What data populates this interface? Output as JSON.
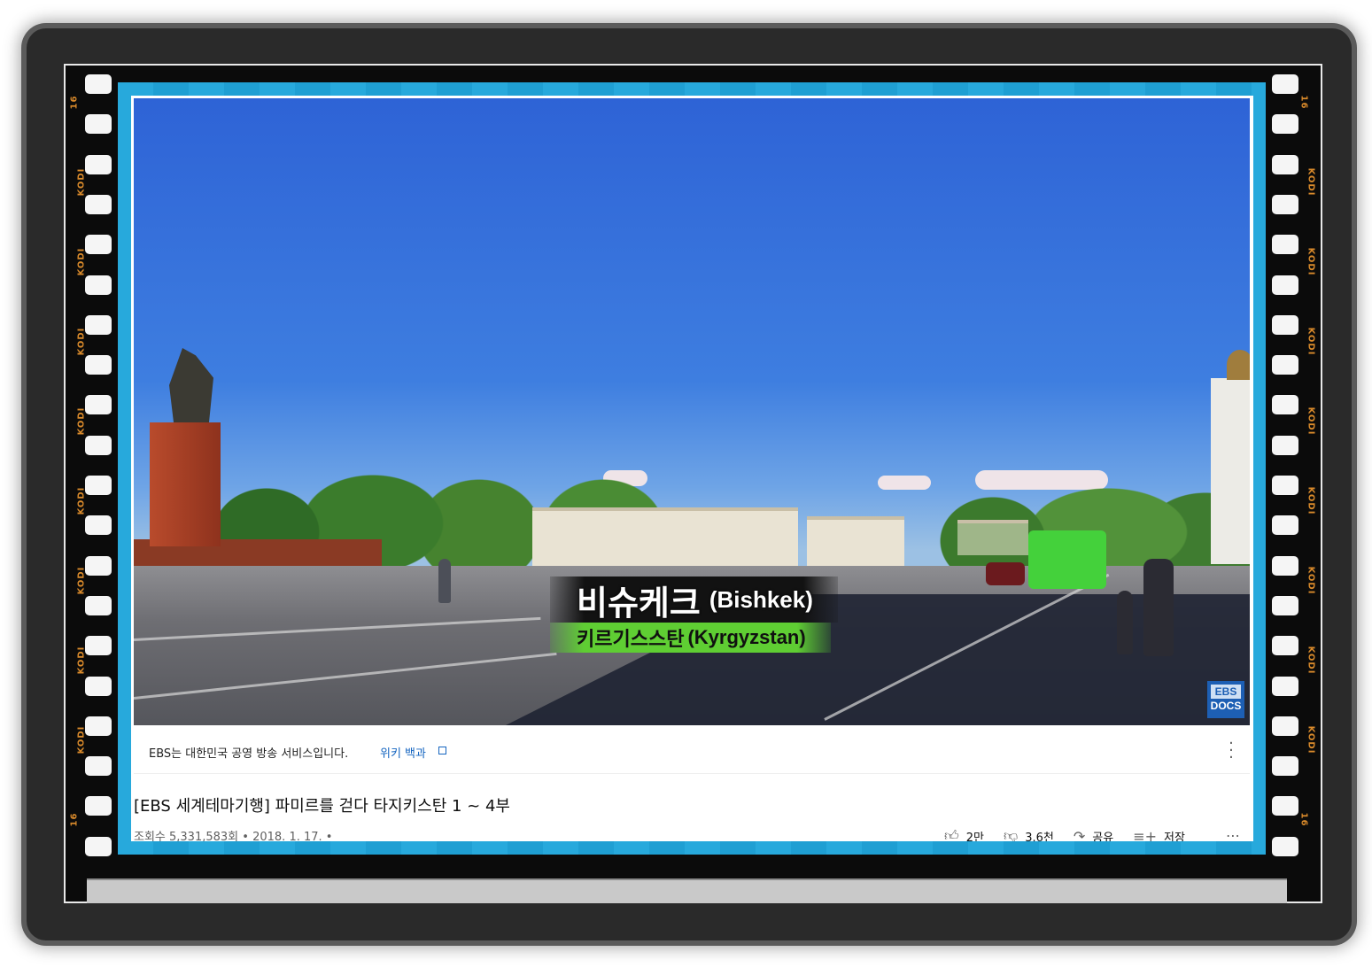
{
  "overlay": {
    "strip_code": "KODI",
    "strip_number": "16"
  },
  "video": {
    "caption": {
      "city_ko": "비슈케크",
      "city_en": "(Bishkek)",
      "country_ko": "키르기스스탄",
      "country_en": "(Kyrgyzstan)"
    },
    "logo": {
      "top": "EBS",
      "bottom": "DOCS"
    }
  },
  "info": {
    "text": "EBS는 대한민국 공영 방송 서비스입니다.",
    "link": "위키 백과",
    "link_icon": "external-link-icon",
    "menu_icon": "more-vert-icon"
  },
  "title": "[EBS 세계테마기행] 파미르를 걷다 타지키스탄 1 ~ 4부",
  "meta": {
    "views": "조회수 5,331,583회",
    "date": "2018. 1. 17.",
    "separator": "•"
  },
  "actions": {
    "like": {
      "icon": "thumbs-up-icon",
      "label": "2만"
    },
    "dislike": {
      "icon": "thumbs-down-icon",
      "label": "3.6천"
    },
    "share": {
      "icon": "share-icon",
      "label": "공유"
    },
    "save": {
      "icon": "playlist-add-icon",
      "label": "저장"
    },
    "more_icon": "more-horiz-icon"
  },
  "colors": {
    "band": "#27a9dc",
    "caption_green": "#5fce33",
    "link_blue": "#1565c0"
  }
}
